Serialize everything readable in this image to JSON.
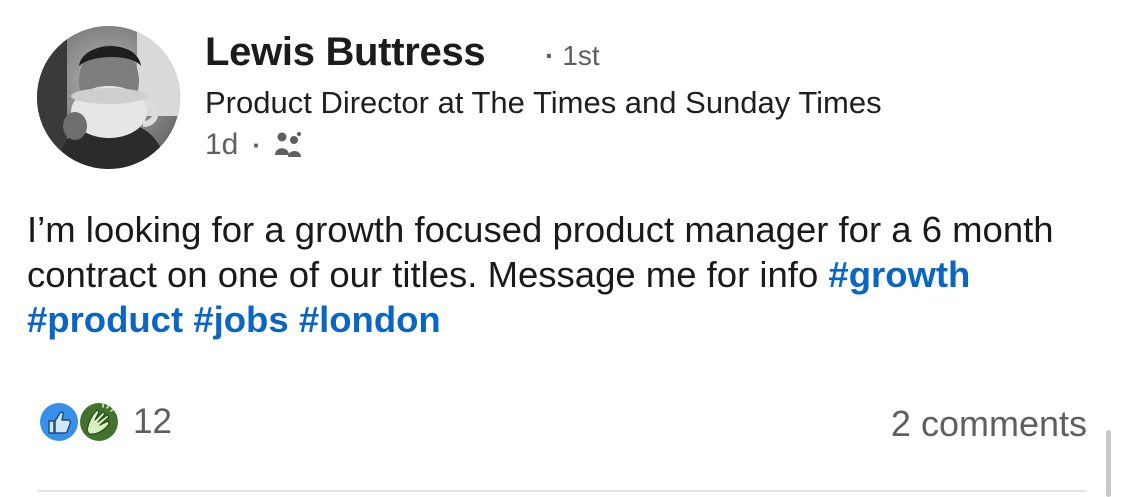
{
  "author": {
    "name": "Lewis Buttress",
    "degree": "1st",
    "headline": "Product Director at The Times and Sunday Times",
    "time_ago": "1d",
    "audience_icon": "connections-icon"
  },
  "post": {
    "text": "I’m looking for a growth focused product manager for a 6 month contract on one of our titles. Message me for info",
    "hashtags": [
      "#growth",
      "#product",
      "#jobs",
      "#london"
    ]
  },
  "social": {
    "reaction_icons": [
      "like-icon",
      "celebrate-icon"
    ],
    "reaction_count": "12",
    "comments_label": "2 comments"
  },
  "colors": {
    "hashtag": "#0a66c2",
    "like": "#378fe9",
    "celebrate": "#44712e",
    "muted_text": "#5f5f5f"
  }
}
